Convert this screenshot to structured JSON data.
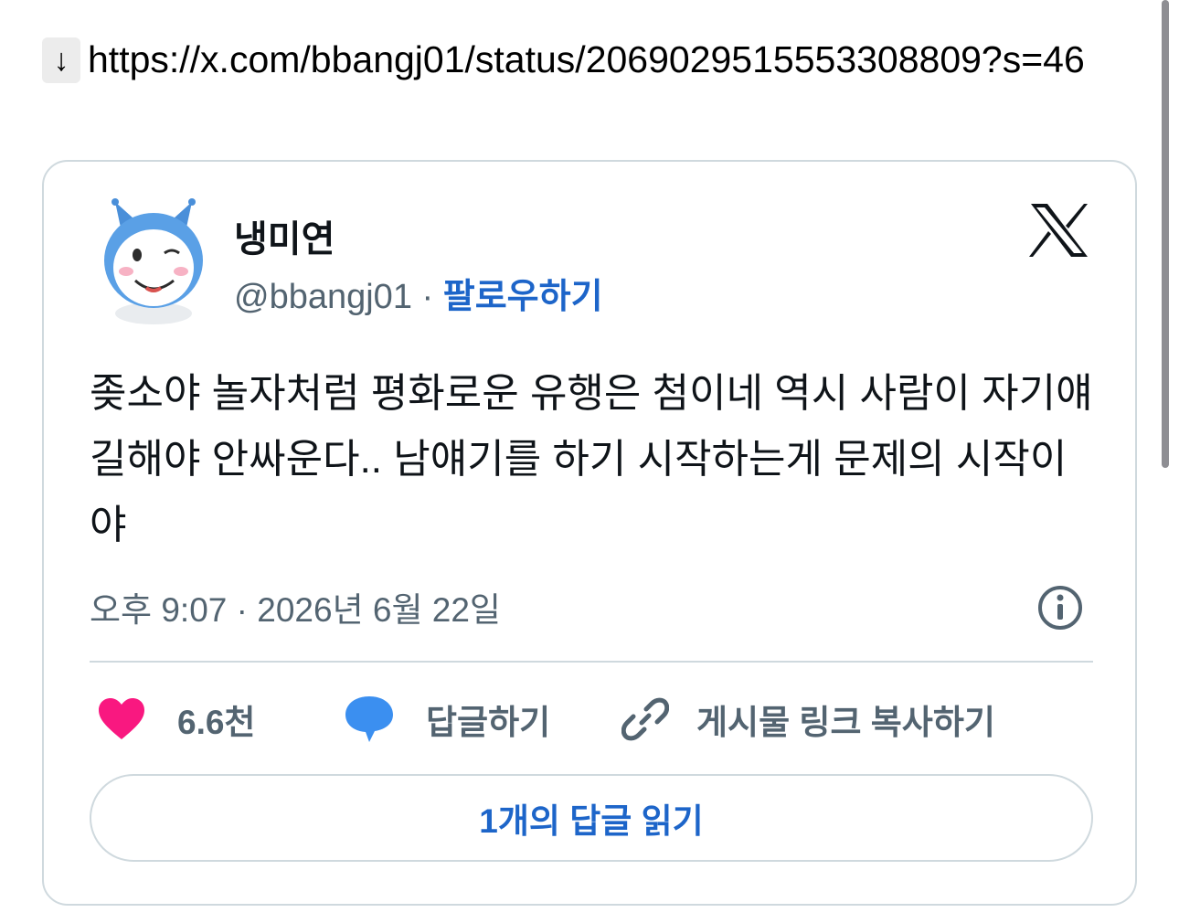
{
  "link": {
    "arrow": "↓",
    "url": "https://x.com/bbangj01/status/2069029515553308809?s=46"
  },
  "author": {
    "name": "냉미연",
    "handle": "@bbangj01",
    "separator": "·",
    "follow_label": "팔로우하기",
    "avatar_icon": "character-avatar-icon"
  },
  "tweet": {
    "text": "좆소야 놀자처럼 평화로운 유행은 첨이네 역시 사람이 자기얘길해야 안싸운다.. 남얘기를 하기 시작하는게 문제의 시작이야",
    "timestamp": "오후 9:07 · 2026년 6월 22일"
  },
  "actions": {
    "likes": "6.6천",
    "reply_label": "답글하기",
    "copy_label": "게시물 링크 복사하기"
  },
  "read_replies_label": "1개의 답글 읽기",
  "colors": {
    "accent": "#1d65c9",
    "heart": "#f91880",
    "reply_bubble": "#3b8ff0",
    "secondary_text": "#536471",
    "border": "#cfd9de"
  }
}
